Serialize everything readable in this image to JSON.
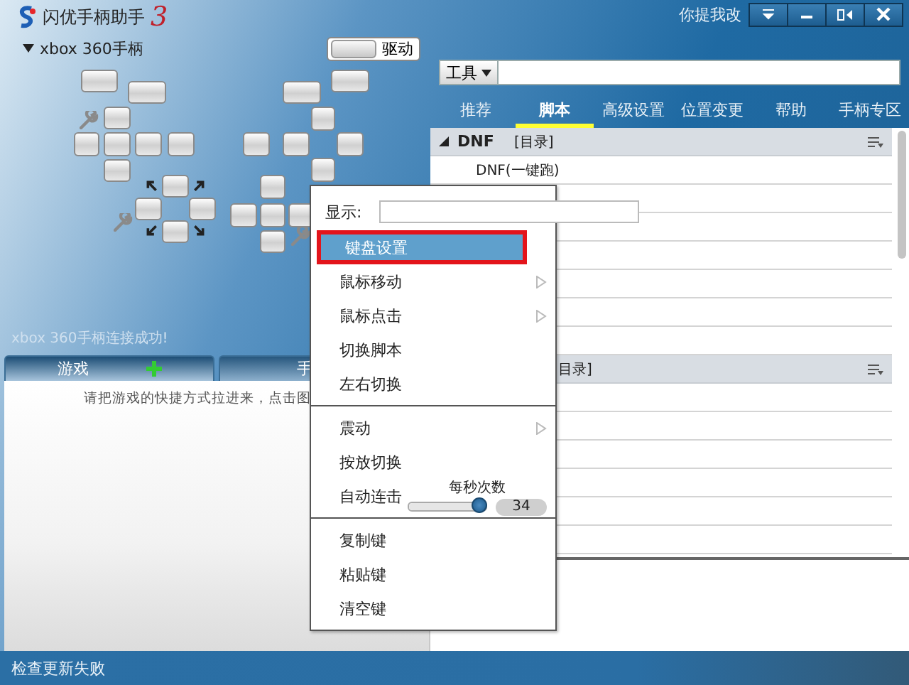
{
  "window": {
    "title": "闪优手柄助手",
    "version_mark": "3",
    "feedback_link": "你提我改"
  },
  "device": {
    "label": "xbox 360手柄",
    "expanded": true
  },
  "driver_button": {
    "label": "驱动",
    "on": false
  },
  "connection_status": "xbox 360手柄连接成功!",
  "left_tabs": [
    {
      "label": "游戏",
      "selected": true,
      "add": true
    },
    {
      "label": "手",
      "selected": false,
      "add": false
    }
  ],
  "games_hint": "请把游戏的快捷方式拉进来，点击图",
  "toolbar": {
    "menu_label": "工具"
  },
  "tabs": [
    {
      "label": "推荐",
      "selected": false
    },
    {
      "label": "脚本",
      "selected": true
    },
    {
      "label": "高级设置",
      "selected": false
    },
    {
      "label": "位置变更",
      "selected": false
    },
    {
      "label": "帮助",
      "selected": false
    },
    {
      "label": "手柄专区",
      "selected": false
    }
  ],
  "script_groups": [
    {
      "label": "DNF",
      "tag": "[目录]",
      "expanded": true,
      "items": [
        "DNF(一键跑)"
      ]
    },
    {
      "tag": "目录]"
    }
  ],
  "context_menu": {
    "display_label": "显示:",
    "groups": [
      [
        {
          "label": "键盘设置",
          "selected": true,
          "submenu": false
        },
        {
          "label": "鼠标移动",
          "selected": false,
          "submenu": true
        },
        {
          "label": "鼠标点击",
          "selected": false,
          "submenu": true
        },
        {
          "label": "切换脚本",
          "selected": false,
          "submenu": false
        },
        {
          "label": "左右切换",
          "selected": false,
          "submenu": false
        }
      ],
      [
        {
          "label": "震动",
          "selected": false,
          "submenu": true
        },
        {
          "label": "按放切换",
          "selected": false,
          "submenu": false
        },
        {
          "label": "自动连击",
          "selected": false,
          "submenu": false,
          "slider": {
            "caption": "每秒次数",
            "level": 0.92,
            "reading": "34"
          }
        }
      ],
      [
        {
          "label": "复制键",
          "selected": false,
          "submenu": false
        },
        {
          "label": "粘贴键",
          "selected": false,
          "submenu": false
        },
        {
          "label": "清空键",
          "selected": false,
          "submenu": false
        }
      ]
    ]
  },
  "status_bar": "检查更新失败"
}
